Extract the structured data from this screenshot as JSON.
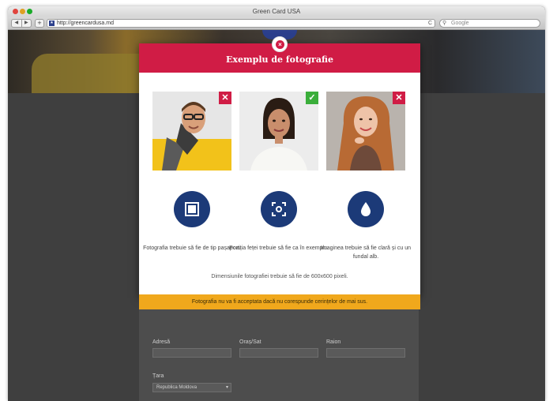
{
  "browser": {
    "title": "Green Card USA",
    "url": "http://greencardusa.md",
    "search_placeholder": "Google",
    "back": "◀",
    "forward": "▶",
    "add": "+",
    "reload": "C"
  },
  "modal": {
    "title": "Exemplu de fotografie",
    "close_icon": "×",
    "photos": [
      {
        "subject": "man-glasses-scarf",
        "status": "bad",
        "mark": "✕"
      },
      {
        "subject": "woman-white-top",
        "status": "good",
        "mark": "✓"
      },
      {
        "subject": "woman-red-hair",
        "status": "bad",
        "mark": "✕"
      }
    ],
    "requirements": [
      {
        "icon": "square-frame-icon",
        "text": "Fotografia trebuie să fie de tip pașaport."
      },
      {
        "icon": "face-focus-icon",
        "text": "Poziția feței trebuie să fie ca în exemplu."
      },
      {
        "icon": "water-drop-icon",
        "text": "Imaginea trebuie să fie clară și cu un fundal alb."
      }
    ],
    "dimensions_note": "Dimensiunile fotografiei trebuie să fie de 600x600 pixeli.",
    "warning": "Fotografia nu va fi acceptata dacă nu corespunde cerințelor de mai sus."
  },
  "form": {
    "labels": {
      "address": "Adresă",
      "city": "Oraș/Sat",
      "district": "Raion",
      "country": "Țara"
    },
    "country_value": "Republica Moldova"
  },
  "colors": {
    "accent": "#d01c45",
    "icon_blue": "#1c3a78",
    "warning": "#f0a81c",
    "ok_green": "#3aae3a"
  }
}
